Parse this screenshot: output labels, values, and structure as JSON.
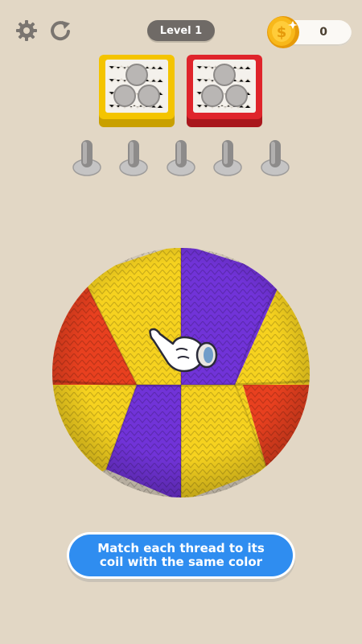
{
  "header": {
    "level_label": "Level 1",
    "coins": "0"
  },
  "spools": [
    {
      "color": "yellow",
      "frame_hex": "#f2c200",
      "slots": 3
    },
    {
      "color": "red",
      "frame_hex": "#e0242b",
      "slots": 3
    }
  ],
  "pegs": {
    "count": 5
  },
  "ball": {
    "segments_colors": [
      "#f6d21f",
      "#7133d8",
      "#e8401f"
    ]
  },
  "hint": {
    "text": "Match each thread to its\ncoil with the same color"
  },
  "icons": [
    "gear-icon",
    "restart-icon",
    "coin-icon",
    "pointing-hand-icon"
  ],
  "colors": {
    "background": "#e2d7c5",
    "accent_blue": "#2f8df0",
    "yellow": "#f6d21f",
    "purple": "#7133d8",
    "red": "#e8401f"
  }
}
